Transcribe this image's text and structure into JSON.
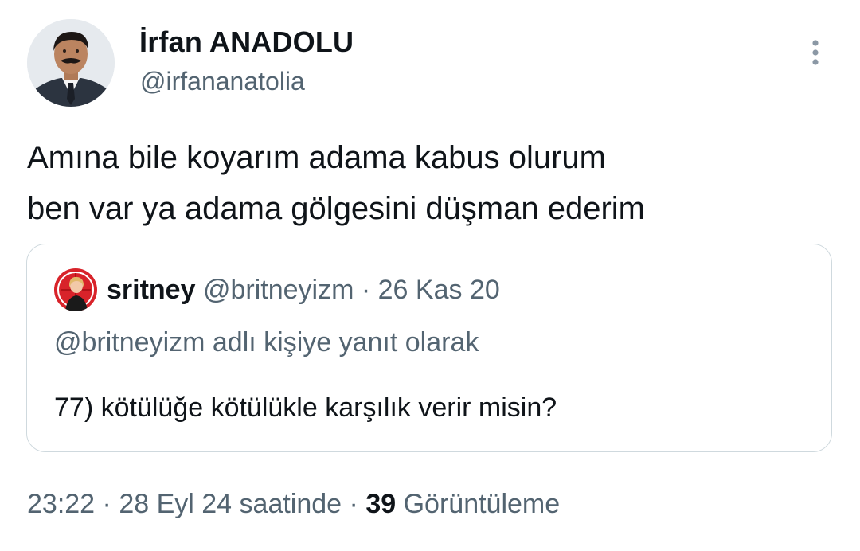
{
  "tweet": {
    "author": {
      "name": "İrfan ANADOLU",
      "handle": "@irfananatolia"
    },
    "text_lines": [
      "Amına bile koyarım adama kabus olurum",
      "ben var ya adama gölgesini düşman ederim"
    ],
    "quoted": {
      "name": "sritney",
      "handle": "@britneyizm",
      "separator": "·",
      "date": "26 Kas 20",
      "reply_context": "@britneyizm adlı kişiye yanıt olarak",
      "text": "77) kötülüğe kötülükle karşılık verir misin?"
    },
    "meta": {
      "time": "23:22",
      "sep1": "·",
      "date": "28 Eyl 24 saatinde",
      "sep2": "·",
      "views_count": "39",
      "views_label": "Görüntüleme"
    }
  },
  "icons": {
    "more": "more-vertical-icon"
  },
  "colors": {
    "text_primary": "#0f1419",
    "text_secondary": "#536471",
    "border": "#cfd9de",
    "background": "#ffffff"
  }
}
